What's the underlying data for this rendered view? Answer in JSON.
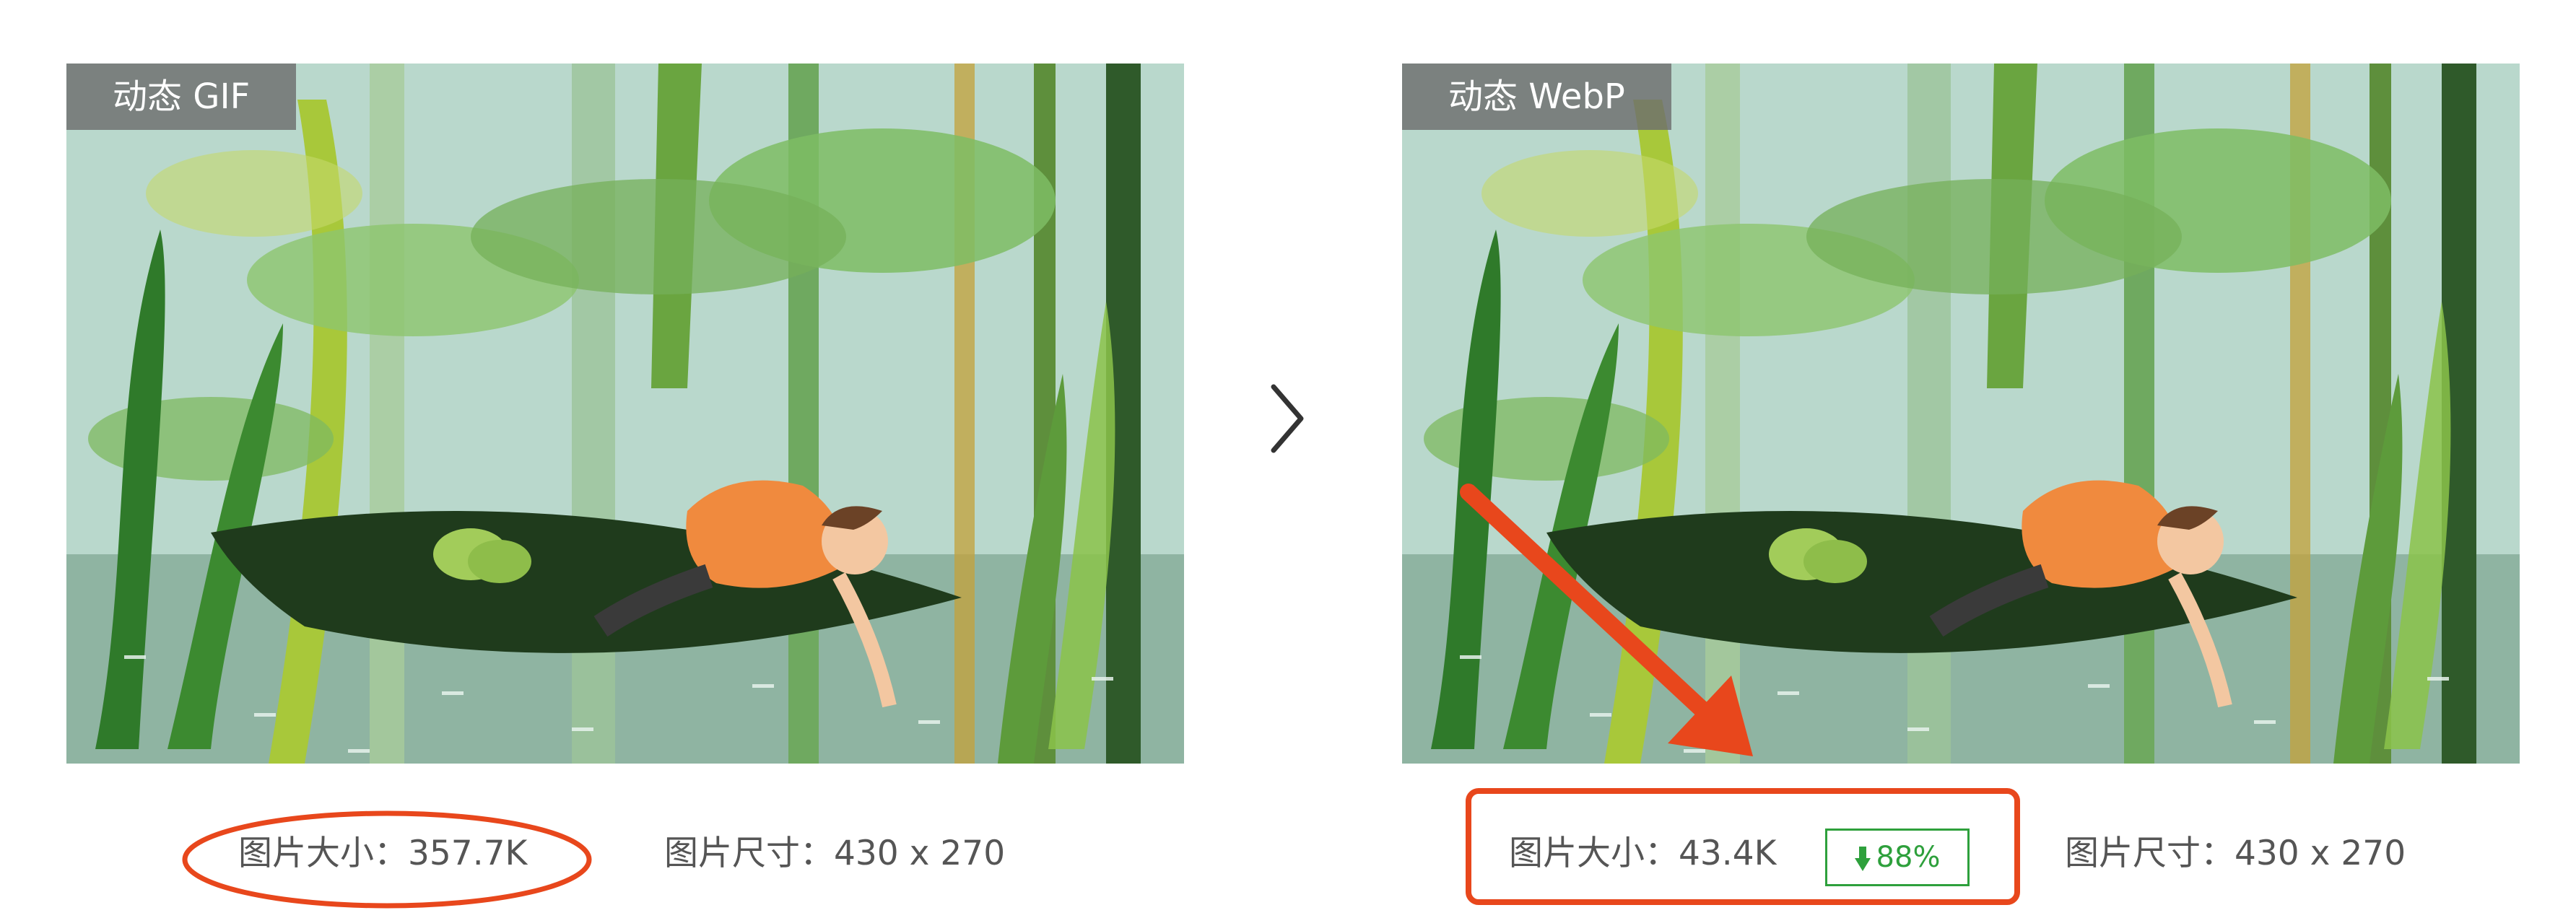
{
  "left": {
    "label": "动态 GIF",
    "file_size": "图片大小：357.7K",
    "dimensions": "图片尺寸：430 x 270"
  },
  "right": {
    "label": "动态 WebP",
    "file_size": "图片大小：43.4K",
    "saving": "88%",
    "dimensions": "图片尺寸：430 x 270"
  },
  "icons": {
    "next": "chevron-right-icon",
    "saving": "arrow-down-icon",
    "pointer": "red-arrow-icon"
  },
  "colors": {
    "highlight": "#e8471c",
    "saving": "#2ea03c",
    "badge": "#6e6e6e"
  }
}
